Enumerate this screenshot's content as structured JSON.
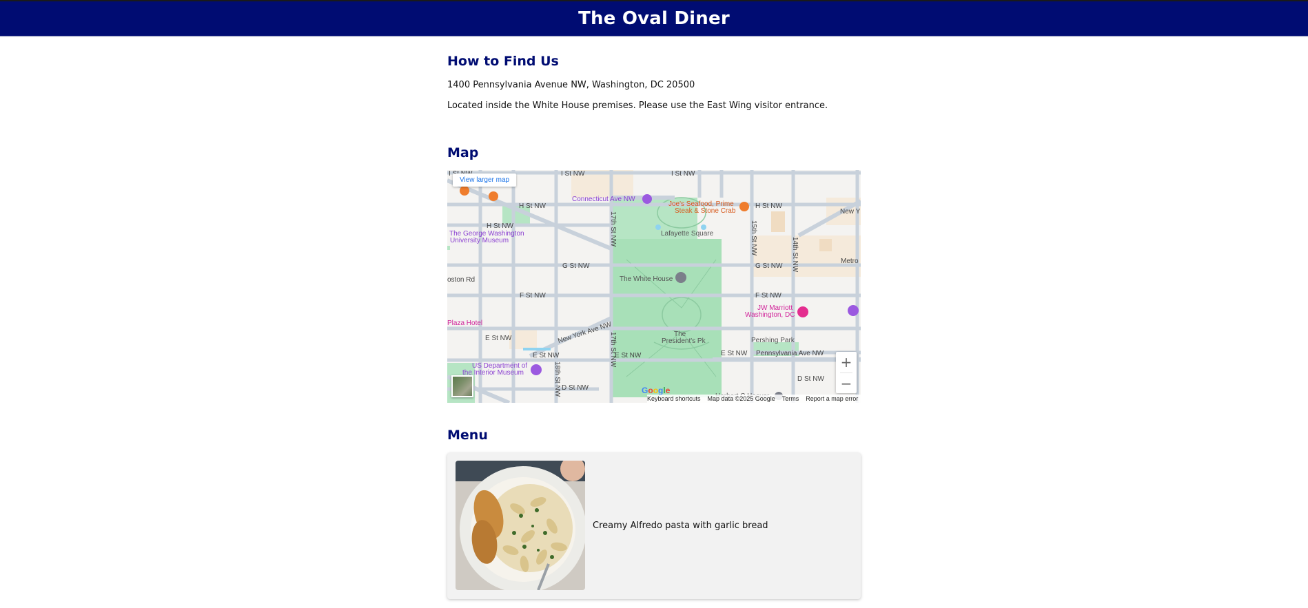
{
  "header": {
    "title": "The Oval Diner",
    "bg_color": "#000c72"
  },
  "find_us": {
    "title": "How to Find Us",
    "address": "1400 Pennsylvania Avenue NW, Washington, DC 20500",
    "note": "Located inside the White House premises. Please use the East Wing visitor entrance."
  },
  "map_section": {
    "title": "Map",
    "view_larger": "View larger map",
    "labels": {
      "i_st_nw_left": "I St NW",
      "i_st_nw_right": "I St NW",
      "h_st_nw": "H St NW",
      "h_st_nw_2": "H St NW",
      "h_st_nw_right": "H St NW",
      "connecticut": "Connecticut Ave NW",
      "joes": "Joe's Seafood, Prime",
      "joes2": "Steak & Stone Crab",
      "lafayette": "Lafayette Square",
      "gwu": "The George Washington",
      "gwu2": "University Museum",
      "g_st_nw": "G St NW",
      "g_st_nw_right": "G St NW",
      "white_house": "The White House",
      "boston_rd": "oston Rd",
      "f_st_nw": "F St NW",
      "f_st_nw_right": "F St NW",
      "jw": "JW Marriott",
      "jw2": "Washington, DC",
      "metro": "Metro",
      "plaza": "Plaza Hotel",
      "ny_ave": "New York Ave NW",
      "e_st_nw": "E St NW",
      "e_st_nw_2": "E St NW",
      "e_st_nw_3": "E St NW",
      "e_st_nw_4": "E St NW",
      "presidents": "The",
      "presidents2": "President's Pk",
      "pershing": "Pershing Park",
      "penn": "Pennsylvania Ave NW",
      "interior": "US Department of",
      "interior2": "the Interior Museum",
      "d_st_nw": "D St NW",
      "d_st_nw_right": "D St NW",
      "st18": "18th St NW",
      "st17": "17th St NW",
      "st17b": "17th St NW",
      "st15": "15th St NW",
      "st14": "14th St NW",
      "newy": "New Y",
      "hoover": "Herbert C Hoover"
    },
    "google": "Google",
    "footer": {
      "shortcuts": "Keyboard shortcuts",
      "map_data": "Map data ©2025 Google",
      "terms": "Terms",
      "report": "Report a map error"
    },
    "zoom_in": "+",
    "zoom_out": "−"
  },
  "menu": {
    "title": "Menu",
    "items": [
      {
        "description": "Creamy Alfredo pasta with garlic bread"
      }
    ]
  }
}
